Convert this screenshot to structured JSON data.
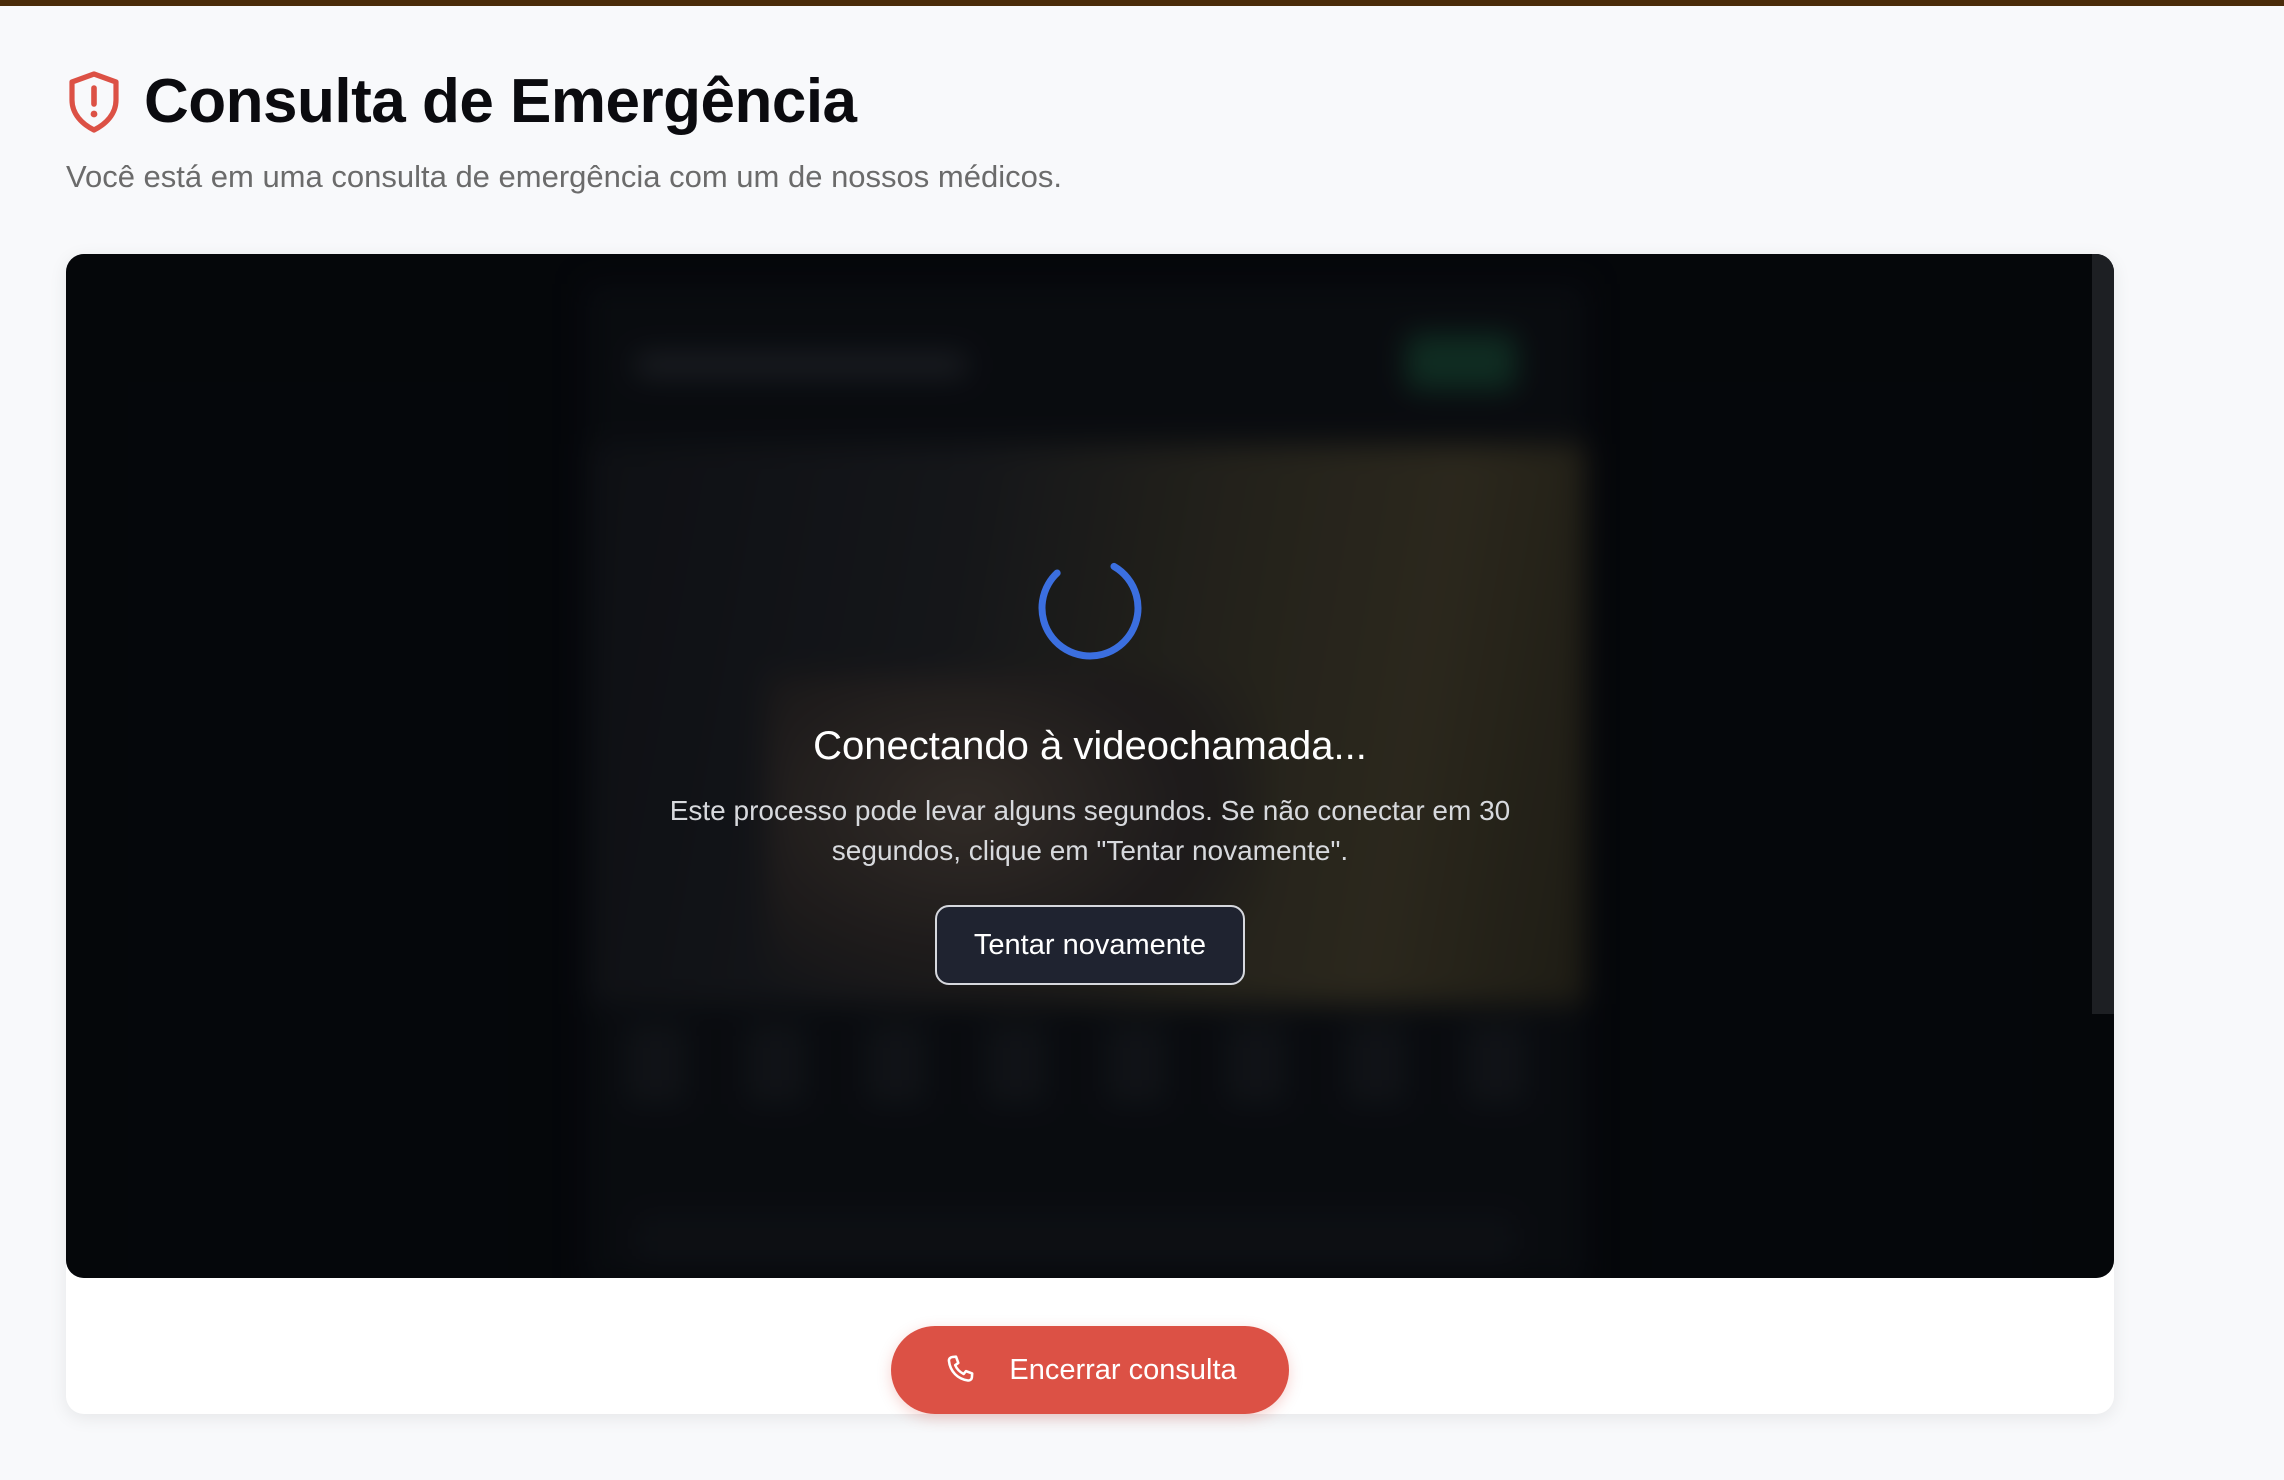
{
  "header": {
    "title": "Consulta de Emergência",
    "subtitle": "Você está em uma consulta de emergência com um de nossos médicos."
  },
  "video": {
    "status_title": "Conectando à videochamada...",
    "status_description": "Este processo pode levar alguns segundos. Se não conectar em 30 segundos, clique em \"Tentar novamente\".",
    "retry_label": "Tentar novamente"
  },
  "actions": {
    "end_label": "Encerrar consulta"
  },
  "icons": {
    "header": "shield-alert-icon",
    "loading": "spinner-icon",
    "end": "phone-icon"
  },
  "colors": {
    "accent_red": "#dc5145",
    "spinner_blue": "#3b6fe0",
    "top_border": "#4a2c0a"
  }
}
